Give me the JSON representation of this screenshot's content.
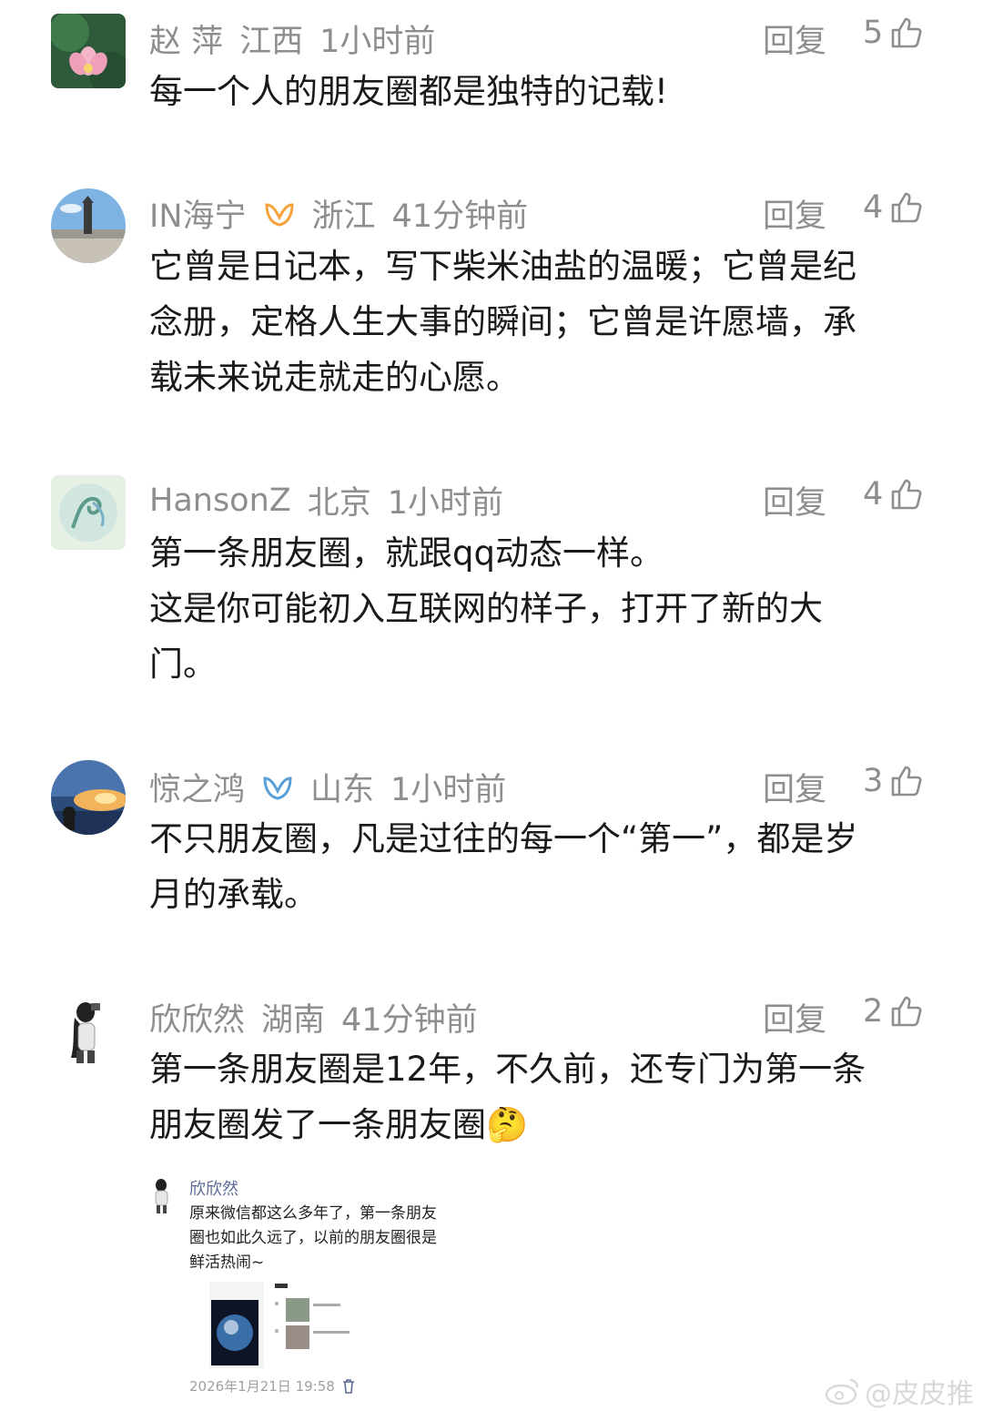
{
  "comments": [
    {
      "user": "赵 萍",
      "location": "江西",
      "time": "1小时前",
      "reply_label": "回复",
      "likes": "5",
      "text": "每一个人的朋友圈都是独特的记载!"
    },
    {
      "user": "IN海宁",
      "location": "浙江",
      "time": "41分钟前",
      "reply_label": "回复",
      "likes": "4",
      "badge_color": "#f5a23a",
      "text": "它曾是日记本，写下柴米油盐的温暖；它曾是纪\n念册，定格人生大事的瞬间；它曾是许愿墙，承\n载未来说走就走的心愿。"
    },
    {
      "user": "HansonZ",
      "location": "北京",
      "time": "1小时前",
      "reply_label": "回复",
      "likes": "4",
      "text": "第一条朋友圈，就跟qq动态一样。\n这是你可能初入互联网的样子，打开了新的大\n门。"
    },
    {
      "user": "惊之鸿",
      "location": "山东",
      "time": "1小时前",
      "reply_label": "回复",
      "likes": "3",
      "badge_color": "#5aa0d8",
      "text": "不只朋友圈，凡是过往的每一个“第一”，都是岁\n月的承载。"
    },
    {
      "user": "欣欣然",
      "location": "湖南",
      "time": "41分钟前",
      "reply_label": "回复",
      "likes": "2",
      "text": "第一条朋友圈是12年，不久前，还专门为第一条\n朋友圈发了一条朋友圈🤔"
    }
  ],
  "quoted_post": {
    "name": "欣欣然",
    "text": "原来微信都这么多年了，第一条朋友\n圈也如此久远了，以前的朋友圈很是\n鲜活热闹~",
    "timestamp": "2026年1月21日 19:58"
  },
  "watermark": {
    "text": "@皮皮推"
  },
  "colors": {
    "meta_gray": "#8e8e8e",
    "name_blue": "#5b6b95"
  }
}
